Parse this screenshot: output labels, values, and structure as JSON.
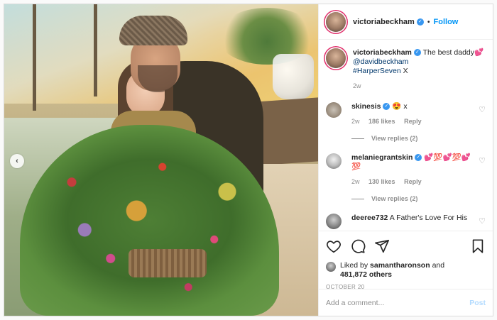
{
  "post": {
    "author": "victoriabeckham",
    "follow_label": "Follow",
    "separator": "•",
    "caption": {
      "text": "The best daddy💕",
      "mention": "@davidbeckham",
      "hashtag": "#HarperSeven",
      "suffix": " X",
      "age": "2w"
    },
    "comments": [
      {
        "username": "skinesis",
        "text": "😍 x",
        "age": "2w",
        "likes": "186 likes",
        "reply_label": "Reply",
        "view_replies": "View replies (2)"
      },
      {
        "username": "melaniegrantskin",
        "text": "💕💯💕💯💕💯",
        "age": "2w",
        "likes": "130 likes",
        "reply_label": "Reply",
        "view_replies": "View replies (2)"
      },
      {
        "username": "deeree732",
        "text": "A Father's Love For His"
      }
    ],
    "liked_by": {
      "prefix": "Liked by",
      "user": "samantharonson",
      "joiner": "and",
      "others": "481,872 others"
    },
    "date": "OCTOBER 20",
    "add_comment_placeholder": "Add a comment...",
    "post_label": "Post"
  },
  "icons": {
    "verified": "✓",
    "prev": "‹",
    "heart_small": "♡"
  },
  "colors": {
    "accent": "#0095f6",
    "verified": "#3897f0",
    "post_disabled": "#b3dbff"
  }
}
